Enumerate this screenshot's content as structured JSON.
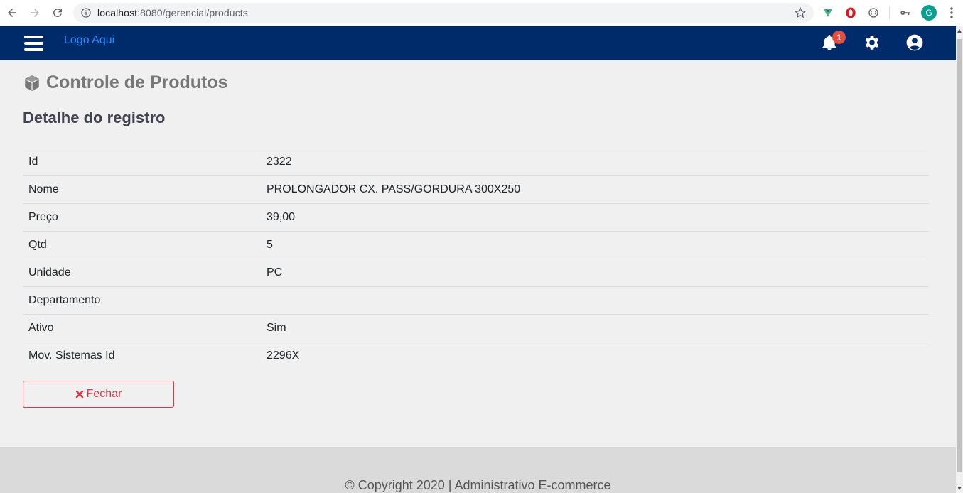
{
  "browser": {
    "url_host": "localhost",
    "url_rest": ":8080/gerencial/products",
    "profile_initial": "G"
  },
  "navbar": {
    "logo": "Logo Aqui",
    "notification_count": "1",
    "bg_color": "#002b6b"
  },
  "page": {
    "title": "Controle de Produtos",
    "section_title": "Detalhe do registro"
  },
  "details": [
    {
      "label": "Id",
      "value": "2322"
    },
    {
      "label": "Nome",
      "value": "PROLONGADOR CX. PASS/GORDURA 300X250"
    },
    {
      "label": "Preço",
      "value": "39,00"
    },
    {
      "label": "Qtd",
      "value": "5"
    },
    {
      "label": "Unidade",
      "value": "PC"
    },
    {
      "label": "Departamento",
      "value": ""
    },
    {
      "label": "Ativo",
      "value": "Sim"
    },
    {
      "label": "Mov. Sistemas Id",
      "value": "2296X"
    }
  ],
  "actions": {
    "close_label": "Fechar"
  },
  "footer": {
    "copyright": "© Copyright 2020 | Administrativo E-commerce"
  }
}
